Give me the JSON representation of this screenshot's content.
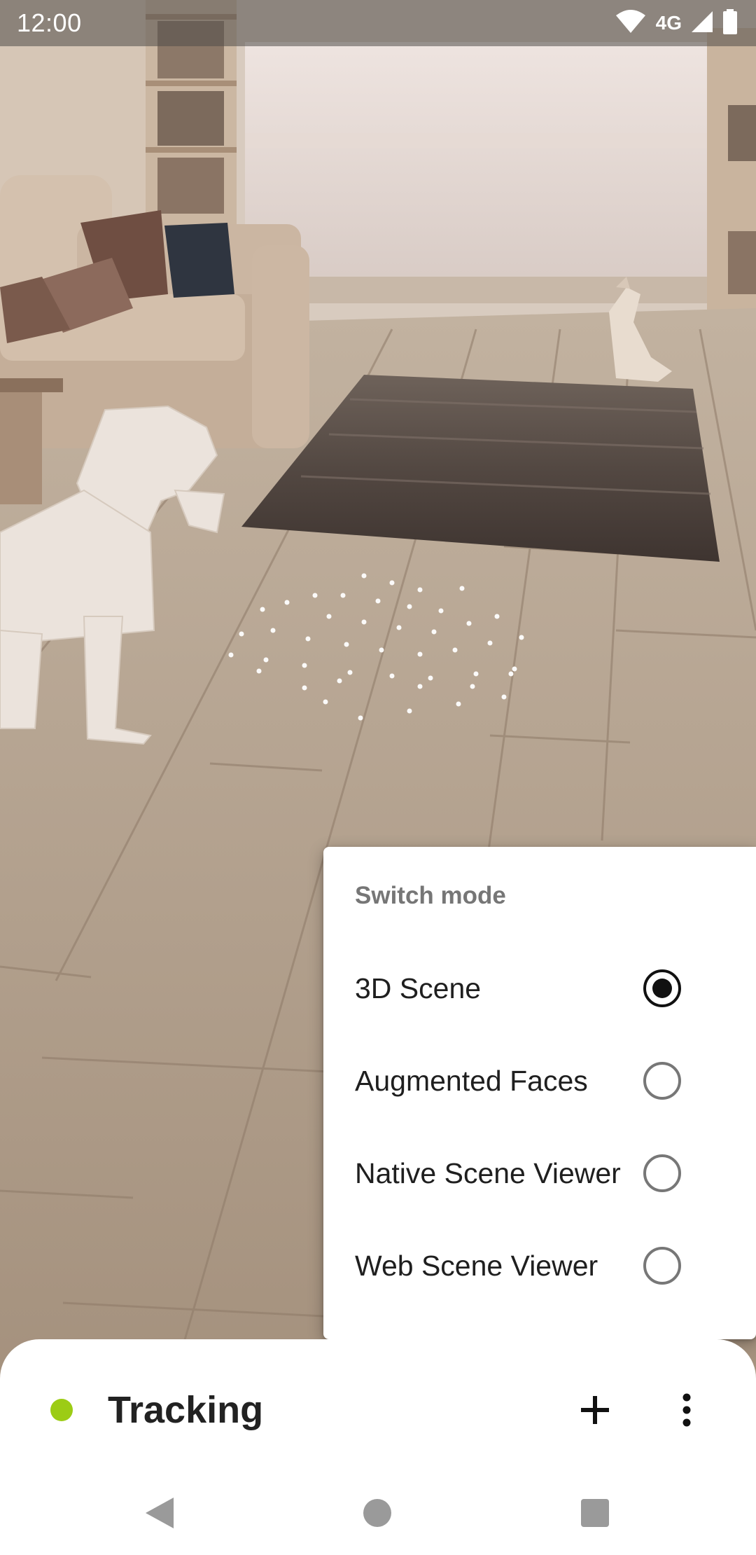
{
  "status_bar": {
    "time": "12:00",
    "network": "4G",
    "icons": [
      "wifi-icon",
      "signal-icon",
      "battery-icon"
    ]
  },
  "mode_menu": {
    "title": "Switch mode",
    "selected": "3D Scene",
    "options": [
      {
        "label": "3D Scene",
        "checked": true
      },
      {
        "label": "Augmented Faces",
        "checked": false
      },
      {
        "label": "Native Scene Viewer",
        "checked": false
      },
      {
        "label": "Web Scene Viewer",
        "checked": false
      }
    ]
  },
  "bottom_sheet": {
    "status_label": "Tracking",
    "status_color": "#9ccc15",
    "add_icon": "plus-icon",
    "more_icon": "more-vert-icon"
  },
  "nav_bar": {
    "icons": [
      "back-icon",
      "home-icon",
      "recents-icon"
    ]
  }
}
